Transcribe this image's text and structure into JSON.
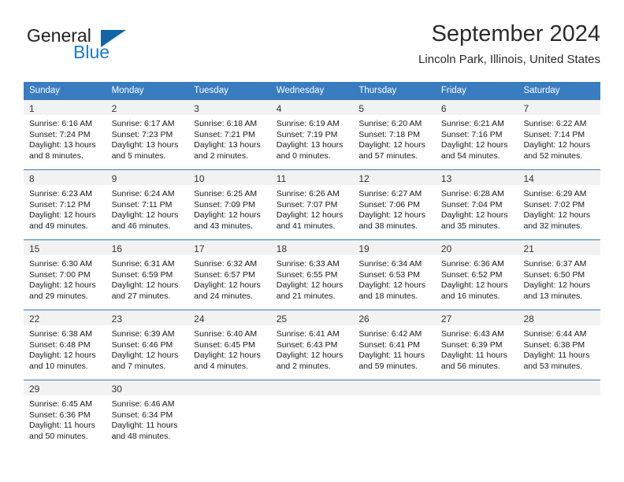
{
  "brand": {
    "name_part1": "General",
    "name_part2": "Blue",
    "accent_color": "#1e7ac4",
    "triangle_color": "#1464a5"
  },
  "header": {
    "title": "September 2024",
    "subtitle": "Lincoln Park, Illinois, United States"
  },
  "theme": {
    "header_bg": "#3a7cc0",
    "daynum_bg": "#f2f2f2",
    "text": "#1a1a1a"
  },
  "weekdays": [
    "Sunday",
    "Monday",
    "Tuesday",
    "Wednesday",
    "Thursday",
    "Friday",
    "Saturday"
  ],
  "weeks": [
    [
      {
        "day": "1",
        "sunrise": "Sunrise: 6:16 AM",
        "sunset": "Sunset: 7:24 PM",
        "daylight1": "Daylight: 13 hours",
        "daylight2": "and 8 minutes."
      },
      {
        "day": "2",
        "sunrise": "Sunrise: 6:17 AM",
        "sunset": "Sunset: 7:23 PM",
        "daylight1": "Daylight: 13 hours",
        "daylight2": "and 5 minutes."
      },
      {
        "day": "3",
        "sunrise": "Sunrise: 6:18 AM",
        "sunset": "Sunset: 7:21 PM",
        "daylight1": "Daylight: 13 hours",
        "daylight2": "and 2 minutes."
      },
      {
        "day": "4",
        "sunrise": "Sunrise: 6:19 AM",
        "sunset": "Sunset: 7:19 PM",
        "daylight1": "Daylight: 13 hours",
        "daylight2": "and 0 minutes."
      },
      {
        "day": "5",
        "sunrise": "Sunrise: 6:20 AM",
        "sunset": "Sunset: 7:18 PM",
        "daylight1": "Daylight: 12 hours",
        "daylight2": "and 57 minutes."
      },
      {
        "day": "6",
        "sunrise": "Sunrise: 6:21 AM",
        "sunset": "Sunset: 7:16 PM",
        "daylight1": "Daylight: 12 hours",
        "daylight2": "and 54 minutes."
      },
      {
        "day": "7",
        "sunrise": "Sunrise: 6:22 AM",
        "sunset": "Sunset: 7:14 PM",
        "daylight1": "Daylight: 12 hours",
        "daylight2": "and 52 minutes."
      }
    ],
    [
      {
        "day": "8",
        "sunrise": "Sunrise: 6:23 AM",
        "sunset": "Sunset: 7:12 PM",
        "daylight1": "Daylight: 12 hours",
        "daylight2": "and 49 minutes."
      },
      {
        "day": "9",
        "sunrise": "Sunrise: 6:24 AM",
        "sunset": "Sunset: 7:11 PM",
        "daylight1": "Daylight: 12 hours",
        "daylight2": "and 46 minutes."
      },
      {
        "day": "10",
        "sunrise": "Sunrise: 6:25 AM",
        "sunset": "Sunset: 7:09 PM",
        "daylight1": "Daylight: 12 hours",
        "daylight2": "and 43 minutes."
      },
      {
        "day": "11",
        "sunrise": "Sunrise: 6:26 AM",
        "sunset": "Sunset: 7:07 PM",
        "daylight1": "Daylight: 12 hours",
        "daylight2": "and 41 minutes."
      },
      {
        "day": "12",
        "sunrise": "Sunrise: 6:27 AM",
        "sunset": "Sunset: 7:06 PM",
        "daylight1": "Daylight: 12 hours",
        "daylight2": "and 38 minutes."
      },
      {
        "day": "13",
        "sunrise": "Sunrise: 6:28 AM",
        "sunset": "Sunset: 7:04 PM",
        "daylight1": "Daylight: 12 hours",
        "daylight2": "and 35 minutes."
      },
      {
        "day": "14",
        "sunrise": "Sunrise: 6:29 AM",
        "sunset": "Sunset: 7:02 PM",
        "daylight1": "Daylight: 12 hours",
        "daylight2": "and 32 minutes."
      }
    ],
    [
      {
        "day": "15",
        "sunrise": "Sunrise: 6:30 AM",
        "sunset": "Sunset: 7:00 PM",
        "daylight1": "Daylight: 12 hours",
        "daylight2": "and 29 minutes."
      },
      {
        "day": "16",
        "sunrise": "Sunrise: 6:31 AM",
        "sunset": "Sunset: 6:59 PM",
        "daylight1": "Daylight: 12 hours",
        "daylight2": "and 27 minutes."
      },
      {
        "day": "17",
        "sunrise": "Sunrise: 6:32 AM",
        "sunset": "Sunset: 6:57 PM",
        "daylight1": "Daylight: 12 hours",
        "daylight2": "and 24 minutes."
      },
      {
        "day": "18",
        "sunrise": "Sunrise: 6:33 AM",
        "sunset": "Sunset: 6:55 PM",
        "daylight1": "Daylight: 12 hours",
        "daylight2": "and 21 minutes."
      },
      {
        "day": "19",
        "sunrise": "Sunrise: 6:34 AM",
        "sunset": "Sunset: 6:53 PM",
        "daylight1": "Daylight: 12 hours",
        "daylight2": "and 18 minutes."
      },
      {
        "day": "20",
        "sunrise": "Sunrise: 6:36 AM",
        "sunset": "Sunset: 6:52 PM",
        "daylight1": "Daylight: 12 hours",
        "daylight2": "and 16 minutes."
      },
      {
        "day": "21",
        "sunrise": "Sunrise: 6:37 AM",
        "sunset": "Sunset: 6:50 PM",
        "daylight1": "Daylight: 12 hours",
        "daylight2": "and 13 minutes."
      }
    ],
    [
      {
        "day": "22",
        "sunrise": "Sunrise: 6:38 AM",
        "sunset": "Sunset: 6:48 PM",
        "daylight1": "Daylight: 12 hours",
        "daylight2": "and 10 minutes."
      },
      {
        "day": "23",
        "sunrise": "Sunrise: 6:39 AM",
        "sunset": "Sunset: 6:46 PM",
        "daylight1": "Daylight: 12 hours",
        "daylight2": "and 7 minutes."
      },
      {
        "day": "24",
        "sunrise": "Sunrise: 6:40 AM",
        "sunset": "Sunset: 6:45 PM",
        "daylight1": "Daylight: 12 hours",
        "daylight2": "and 4 minutes."
      },
      {
        "day": "25",
        "sunrise": "Sunrise: 6:41 AM",
        "sunset": "Sunset: 6:43 PM",
        "daylight1": "Daylight: 12 hours",
        "daylight2": "and 2 minutes."
      },
      {
        "day": "26",
        "sunrise": "Sunrise: 6:42 AM",
        "sunset": "Sunset: 6:41 PM",
        "daylight1": "Daylight: 11 hours",
        "daylight2": "and 59 minutes."
      },
      {
        "day": "27",
        "sunrise": "Sunrise: 6:43 AM",
        "sunset": "Sunset: 6:39 PM",
        "daylight1": "Daylight: 11 hours",
        "daylight2": "and 56 minutes."
      },
      {
        "day": "28",
        "sunrise": "Sunrise: 6:44 AM",
        "sunset": "Sunset: 6:38 PM",
        "daylight1": "Daylight: 11 hours",
        "daylight2": "and 53 minutes."
      }
    ],
    [
      {
        "day": "29",
        "sunrise": "Sunrise: 6:45 AM",
        "sunset": "Sunset: 6:36 PM",
        "daylight1": "Daylight: 11 hours",
        "daylight2": "and 50 minutes."
      },
      {
        "day": "30",
        "sunrise": "Sunrise: 6:46 AM",
        "sunset": "Sunset: 6:34 PM",
        "daylight1": "Daylight: 11 hours",
        "daylight2": "and 48 minutes."
      },
      {
        "day": "",
        "sunrise": "",
        "sunset": "",
        "daylight1": "",
        "daylight2": ""
      },
      {
        "day": "",
        "sunrise": "",
        "sunset": "",
        "daylight1": "",
        "daylight2": ""
      },
      {
        "day": "",
        "sunrise": "",
        "sunset": "",
        "daylight1": "",
        "daylight2": ""
      },
      {
        "day": "",
        "sunrise": "",
        "sunset": "",
        "daylight1": "",
        "daylight2": ""
      },
      {
        "day": "",
        "sunrise": "",
        "sunset": "",
        "daylight1": "",
        "daylight2": ""
      }
    ]
  ]
}
